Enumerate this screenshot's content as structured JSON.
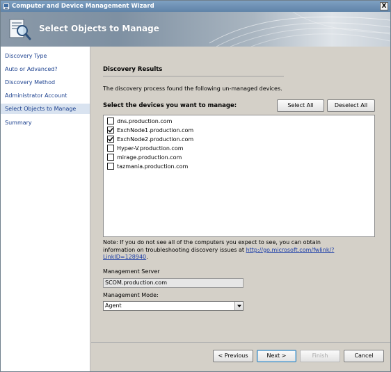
{
  "window": {
    "title": "Computer and Device Management Wizard",
    "close_label": "X"
  },
  "banner": {
    "title": "Select Objects to Manage"
  },
  "nav": {
    "items": [
      {
        "label": "Discovery Type",
        "active": false
      },
      {
        "label": "Auto or Advanced?",
        "active": false
      },
      {
        "label": "Discovery Method",
        "active": false
      },
      {
        "label": "Administrator Account",
        "active": false
      },
      {
        "label": "Select Objects to Manage",
        "active": true
      },
      {
        "label": "Summary",
        "active": false
      }
    ]
  },
  "main": {
    "section_title": "Discovery Results",
    "intro": "The discovery process found the following un-managed devices.",
    "devices_label": "Select the devices you want to manage:",
    "select_all": "Select All",
    "deselect_all": "Deselect All",
    "devices": [
      {
        "name": "dns.production.com",
        "checked": false
      },
      {
        "name": "ExchNode1.production.com",
        "checked": true
      },
      {
        "name": "ExchNode2.production.com",
        "checked": true
      },
      {
        "name": "Hyper-V.production.com",
        "checked": false
      },
      {
        "name": "mirage.production.com",
        "checked": false
      },
      {
        "name": "tazmania.production.com",
        "checked": false
      }
    ],
    "note_prefix": "Note: If you do not see all of the computers you expect to see, you can obtain information on troubleshooting discovery issues at ",
    "note_link": "http://go.microsoft.com/fwlink/?LinkID=128940",
    "note_suffix": ".",
    "management_server_label": "Management Server",
    "management_server_value": "SCOM.production.com",
    "management_mode_label": "Management Mode:",
    "management_mode_value": "Agent"
  },
  "footer": {
    "previous": "< Previous",
    "next": "Next >",
    "finish": "Finish",
    "cancel": "Cancel"
  }
}
